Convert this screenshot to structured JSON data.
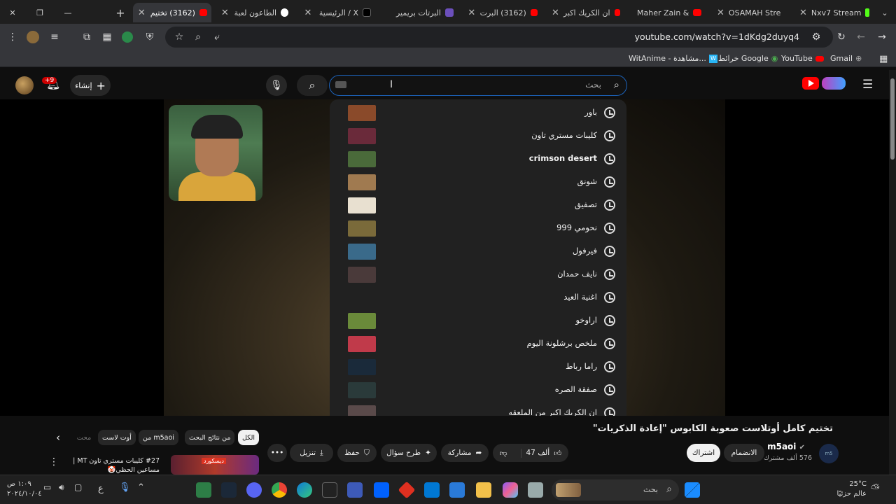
{
  "browser": {
    "tabs": [
      {
        "title": "(3162) تختيم",
        "favicon": "youtube",
        "active": true
      },
      {
        "title": "الطاعون لعبة",
        "favicon": "google"
      },
      {
        "title": "الرئيسية / X",
        "favicon": "x"
      },
      {
        "title": "البرتات بريمير",
        "favicon": "twitch"
      },
      {
        "title": "(3162) البرت",
        "favicon": "youtube"
      },
      {
        "title": "ان الكريك اكبر",
        "favicon": "youtube"
      },
      {
        "title": "Maher Zain &",
        "favicon": "youtube"
      },
      {
        "title": "OSAMAH Stre",
        "favicon": "kick"
      },
      {
        "title": "Nxv7 Stream",
        "favicon": "kick"
      }
    ],
    "new_tab": "+",
    "url": "youtube.com/watch?v=1dKdg2duyq4",
    "extensions_badge": "8",
    "bookmarks": [
      {
        "label": "Gmail",
        "icon": "gmail-icon"
      },
      {
        "label": "YouTube",
        "icon": "youtube-icon"
      },
      {
        "label": "خرائط Google",
        "icon": "maps-icon"
      },
      {
        "label": "WitAnime - مشاهدة...",
        "icon": "witanime-icon"
      }
    ]
  },
  "youtube": {
    "search_placeholder": "بحث",
    "create_label": "إنشاء",
    "notif_count": "+9",
    "suggestions": [
      {
        "text": "باور",
        "thumb": "#8a4a2a"
      },
      {
        "text": "كليبات مستري تاون",
        "thumb": "#6a2a3a"
      },
      {
        "text": "crimson desert",
        "thumb": "#4a6a3a",
        "bold": true
      },
      {
        "text": "شونق",
        "thumb": "#a07a50"
      },
      {
        "text": "تصفيق",
        "thumb": "#e8e0d0"
      },
      {
        "text": "نحومي 999",
        "thumb": "#7a6a3a"
      },
      {
        "text": "فيرفول",
        "thumb": "#3a6a8a"
      },
      {
        "text": "نايف حمدان",
        "thumb": "#4a3a3a"
      },
      {
        "text": "اغنية العيد",
        "thumb": ""
      },
      {
        "text": "اراوخو",
        "thumb": "#6a8a3a"
      },
      {
        "text": "ملخص برشلونة اليوم",
        "thumb": "#c03a4a"
      },
      {
        "text": "راما رباط",
        "thumb": "#1a2a3a"
      },
      {
        "text": "صفقة الصره",
        "thumb": "#2a3a3a"
      },
      {
        "text": "ان الكريك اكبر من الملعقه",
        "thumb": "#5a4a4a"
      }
    ],
    "video": {
      "title": "تختيم كامل أوتلاست صعوبة الكابوس \"إعادة الذكريات\"",
      "channel": "m5aoi",
      "subscribers": "576 ألف مشترك",
      "join_label": "الانضمام",
      "subscribe_label": "اشتراك",
      "likes": "47 ألف",
      "share_label": "مشاركة",
      "ask_label": "طرح سؤال",
      "save_label": "حفظ",
      "download_label": "تنزيل",
      "more": "•••"
    },
    "chips": [
      "الكل",
      "من نتائج البحث",
      "من m5aoi",
      "أوت لاست",
      "محت"
    ],
    "recommended": {
      "title": "#27 كليبات مستري تاون MT | مساعين الحظي🤡",
      "badge": "ديسكورد"
    }
  },
  "taskbar": {
    "search_label": "بحث",
    "weather_temp": "25°C",
    "weather_desc": "عالم حزئيًا",
    "time": "١:٠٩ ص",
    "date": "٢٠٢٤/١٠/٠٤",
    "lang": "ع"
  }
}
